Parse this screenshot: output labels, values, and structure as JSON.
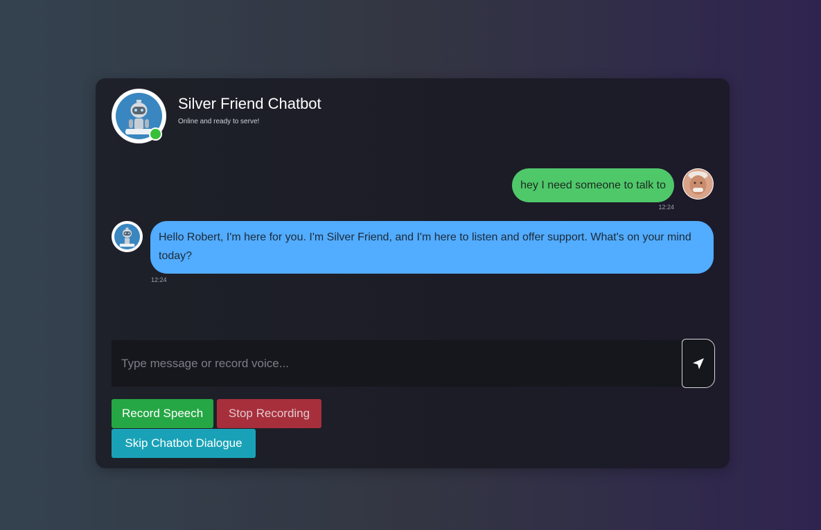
{
  "header": {
    "title": "Silver Friend Chatbot",
    "subtitle": "Online and ready to serve!",
    "status_color": "#39c03a"
  },
  "messages": [
    {
      "sender": "user",
      "text": "hey I need someone to talk to",
      "time": "12:24",
      "bubble_color": "#4fc86a"
    },
    {
      "sender": "bot",
      "text": "Hello Robert, I'm here for you. I'm Silver Friend, and I'm here to listen and offer support. What's on your mind today?",
      "time": "12:24",
      "bubble_color": "#52acff"
    }
  ],
  "composer": {
    "placeholder": "Type message or record voice...",
    "value": "",
    "send_icon": "send-icon"
  },
  "actions": {
    "record_label": "Record Speech",
    "stop_label": "Stop Recording",
    "skip_label": "Skip Chatbot Dialogue"
  },
  "colors": {
    "record": "#26a745",
    "stop": "#a72f3c",
    "skip": "#19a2b7"
  }
}
